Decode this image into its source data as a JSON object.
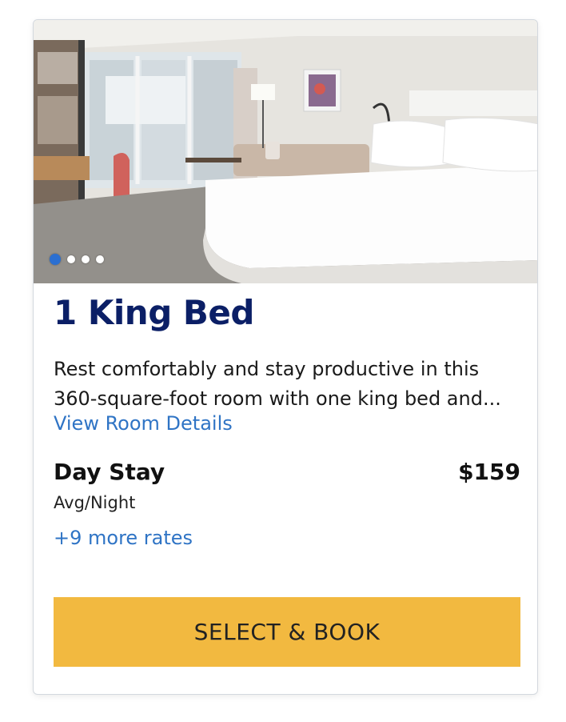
{
  "room": {
    "title": "1 King Bed",
    "description": "Rest comfortably and stay productive in this 360-square-foot room with one king bed and...",
    "details_link": "View Room Details"
  },
  "gallery": {
    "image_count": 4,
    "active_index": 0
  },
  "rate": {
    "name": "Day Stay",
    "price": "$159",
    "unit": "Avg/Night",
    "more_rates": "+9 more rates"
  },
  "actions": {
    "book_label": "SELECT & BOOK"
  },
  "colors": {
    "title": "#0b1f66",
    "link": "#2f74c5",
    "button": "#f2b940",
    "active_dot": "#2b6fd1"
  }
}
